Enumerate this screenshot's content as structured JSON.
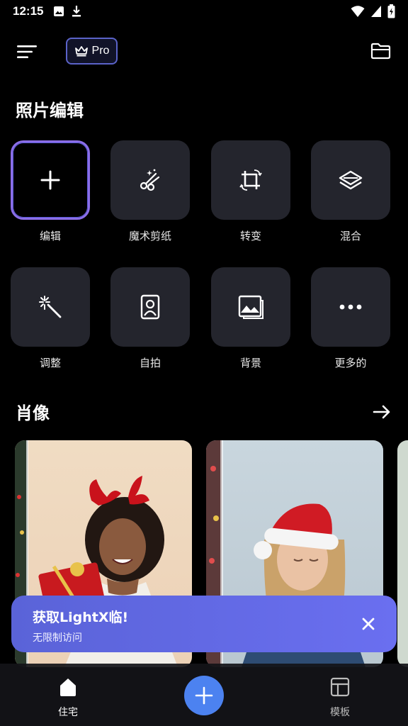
{
  "status": {
    "time": "12:15"
  },
  "header": {
    "pro_label": "Pro"
  },
  "photo_edit": {
    "title": "照片编辑",
    "tools": [
      {
        "label": "编辑",
        "icon": "plus-icon"
      },
      {
        "label": "魔术剪纸",
        "icon": "magic-scissors-icon"
      },
      {
        "label": "转变",
        "icon": "crop-rotate-icon"
      },
      {
        "label": "混合",
        "icon": "layers-icon"
      },
      {
        "label": "调整",
        "icon": "magic-wand-icon"
      },
      {
        "label": "自拍",
        "icon": "selfie-portrait-icon"
      },
      {
        "label": "背景",
        "icon": "background-image-icon"
      },
      {
        "label": "更多的",
        "icon": "more-dots-icon"
      }
    ]
  },
  "portrait": {
    "title": "肖像"
  },
  "promo": {
    "title": "获取LightX临!",
    "subtitle": "无限制访问"
  },
  "bottom_nav": {
    "home_label": "住宅",
    "templates_label": "模板"
  },
  "colors": {
    "accent": "#4c82f0",
    "promo": "#5f66e2",
    "tile": "#24252d"
  }
}
